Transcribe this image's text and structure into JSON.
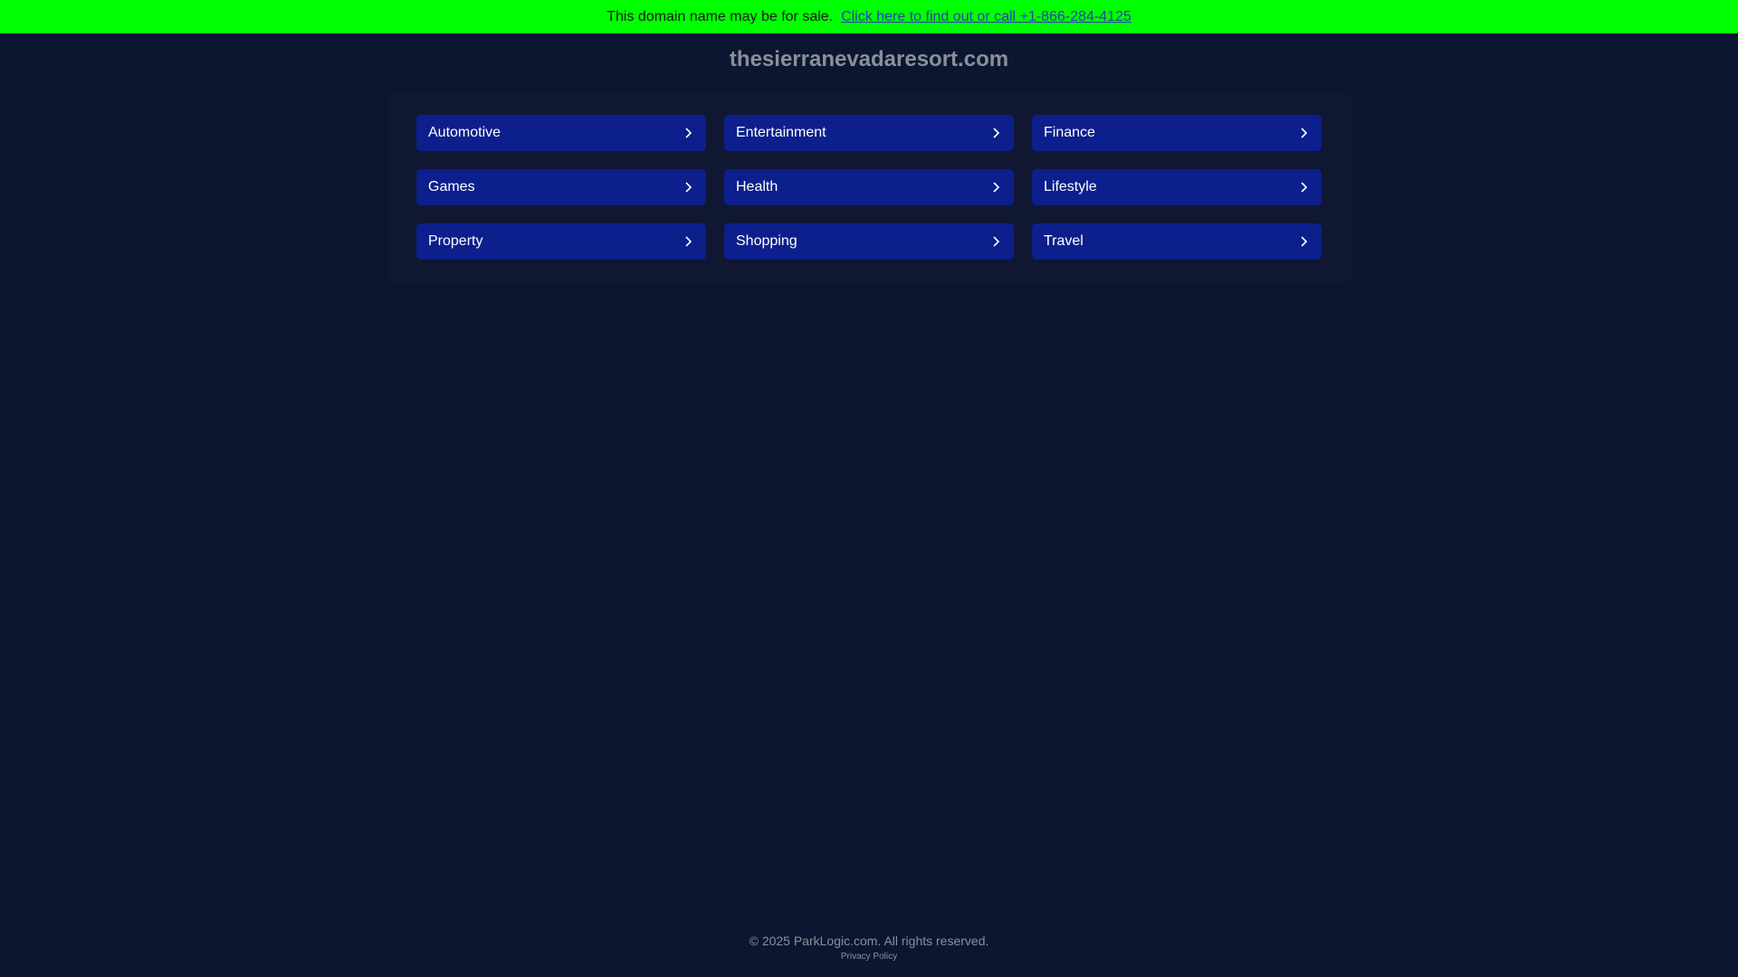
{
  "banner": {
    "text": "This domain name may be for sale.",
    "link_text": "Click here to find out or call +1-866-284-4125"
  },
  "domain": "thesierranevadaresort.com",
  "categories": [
    {
      "label": "Automotive",
      "icon": "chevron-right-icon"
    },
    {
      "label": "Entertainment",
      "icon": "chevron-right-icon"
    },
    {
      "label": "Finance",
      "icon": "chevron-right-icon"
    },
    {
      "label": "Games",
      "icon": "chevron-right-icon"
    },
    {
      "label": "Health",
      "icon": "chevron-right-icon"
    },
    {
      "label": "Lifestyle",
      "icon": "chevron-right-icon"
    },
    {
      "label": "Property",
      "icon": "chevron-right-icon"
    },
    {
      "label": "Shopping",
      "icon": "chevron-right-icon"
    },
    {
      "label": "Travel",
      "icon": "chevron-right-icon"
    }
  ],
  "footer": {
    "copyright": "© 2025 ParkLogic.com. All rights reserved.",
    "privacy": "Privacy Policy"
  },
  "colors": {
    "banner_bg": "#00ff00",
    "page_bg": "#0d1630",
    "button_bg": "#0c1f8c",
    "muted_text": "#8a8f9c"
  }
}
